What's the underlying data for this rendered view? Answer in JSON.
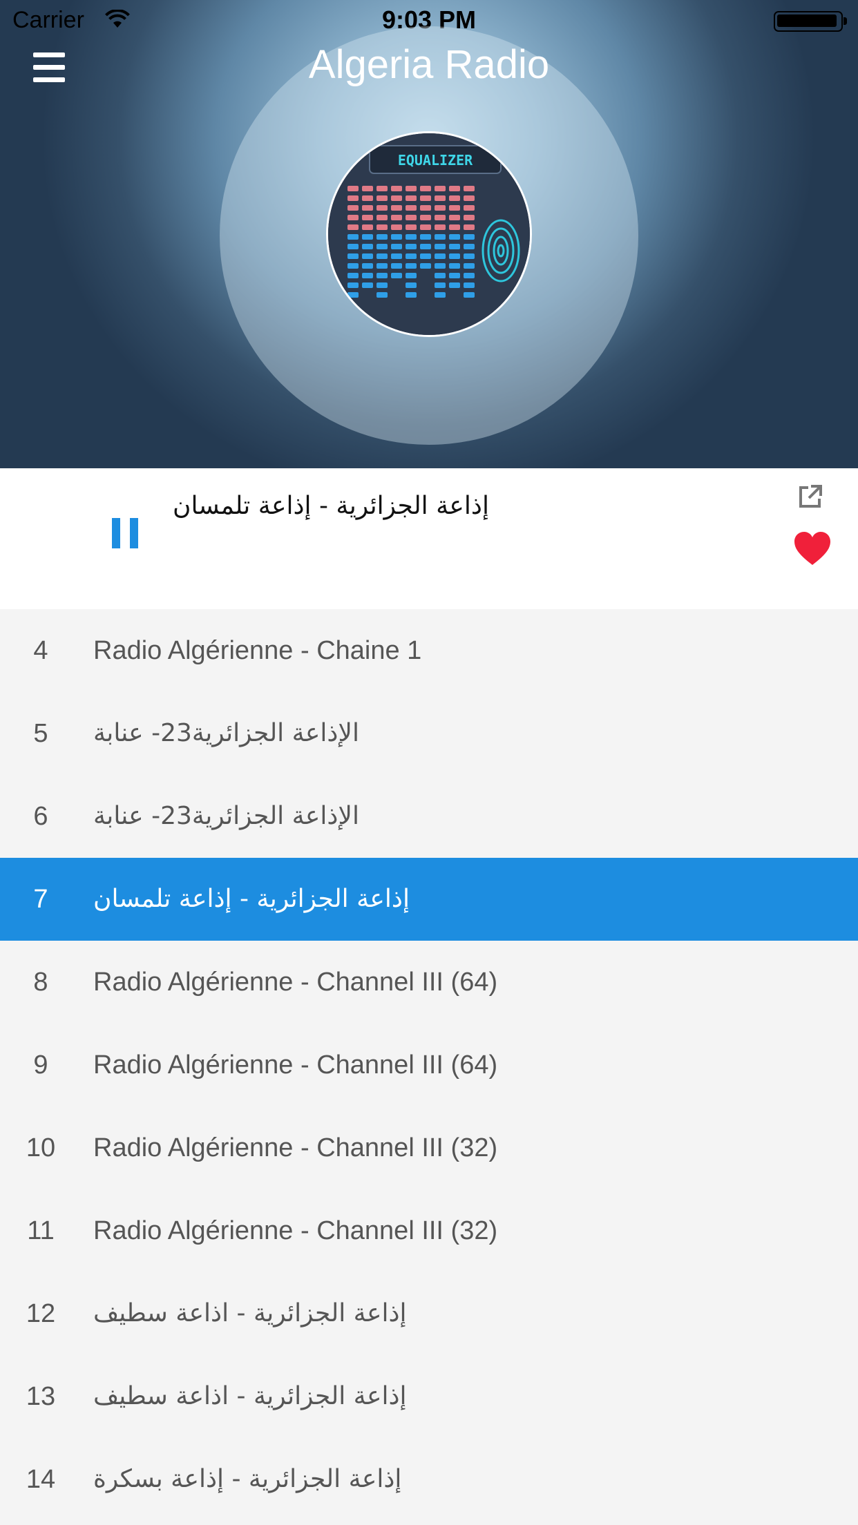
{
  "status_bar": {
    "carrier": "Carrier",
    "time": "9:03 PM"
  },
  "header": {
    "title": "Algeria Radio",
    "menu_icon": "hamburger-menu-icon",
    "artwork_label": "EQUALIZER"
  },
  "now_playing": {
    "station": "إذاعة الجزائرية - إذاعة تلمسان",
    "state": "playing",
    "favorite": true,
    "colors": {
      "accent": "#1d8de0",
      "heart": "#f0203a"
    }
  },
  "stations": [
    {
      "number": "4",
      "name": "Radio Algérienne - Chaine 1",
      "rtl": false,
      "active": false
    },
    {
      "number": "5",
      "name": "الإذاعة الجزائرية23- عنابة",
      "rtl": true,
      "active": false
    },
    {
      "number": "6",
      "name": "الإذاعة الجزائرية23- عنابة",
      "rtl": true,
      "active": false
    },
    {
      "number": "7",
      "name": "إذاعة الجزائرية - إذاعة تلمسان",
      "rtl": true,
      "active": true
    },
    {
      "number": "8",
      "name": "Radio Algérienne - Channel III (64)",
      "rtl": false,
      "active": false
    },
    {
      "number": "9",
      "name": "Radio Algérienne - Channel III (64)",
      "rtl": false,
      "active": false
    },
    {
      "number": "10",
      "name": "Radio Algérienne - Channel III (32)",
      "rtl": false,
      "active": false
    },
    {
      "number": "11",
      "name": "Radio Algérienne - Channel III (32)",
      "rtl": false,
      "active": false
    },
    {
      "number": "12",
      "name": "إذاعة الجزائرية - اذاعة سطيف",
      "rtl": true,
      "active": false
    },
    {
      "number": "13",
      "name": "إذاعة الجزائرية - اذاعة سطيف",
      "rtl": true,
      "active": false
    },
    {
      "number": "14",
      "name": "إذاعة الجزائرية - إذاعة بسكرة",
      "rtl": true,
      "active": false
    }
  ]
}
